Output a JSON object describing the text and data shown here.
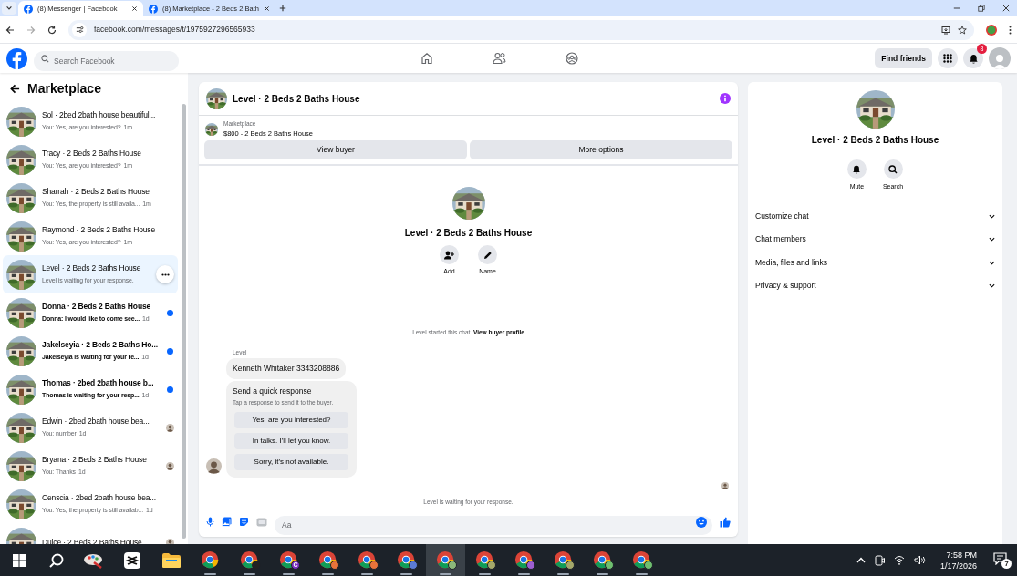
{
  "browser": {
    "tabs": [
      {
        "title": "(8) Messenger | Facebook",
        "selected": true
      },
      {
        "title": "(8) Marketplace - 2 Beds 2 Bath",
        "selected": false
      }
    ],
    "url": "facebook.com/messages/t/1975927296565933"
  },
  "header": {
    "search_placeholder": "Search Facebook",
    "find_friends": "Find friends",
    "notification_count": "8"
  },
  "sidebar": {
    "title": "Marketplace",
    "conversations": [
      {
        "name": "Sol · 2bed 2bath house beautiful...",
        "preview": "You: Yes, are you interested?",
        "time": "1m",
        "unread": false,
        "selected": false,
        "seen": false
      },
      {
        "name": "Tracy · 2 Beds 2 Baths House",
        "preview": "You: Yes, are you interested?",
        "time": "1m",
        "unread": false,
        "selected": false,
        "seen": false
      },
      {
        "name": "Sharrah · 2 Beds 2 Baths House",
        "preview": "You: Yes, the property is still availa...",
        "time": "1m",
        "unread": false,
        "selected": false,
        "seen": false
      },
      {
        "name": "Raymond · 2 Beds 2 Baths House",
        "preview": "You: Yes, are you interested?",
        "time": "1m",
        "unread": false,
        "selected": false,
        "seen": false
      },
      {
        "name": "Level · 2 Beds 2 Baths House",
        "preview": "Level is waiting for your response.",
        "unread": false,
        "selected": true,
        "seen": false
      },
      {
        "name": "Donna · 2 Beds 2 Baths House",
        "preview": "Donna: I would like to come see...",
        "time": "1d",
        "unread": true,
        "selected": false,
        "seen": false
      },
      {
        "name": "Jakelseyia · 2 Beds 2 Baths Ho...",
        "preview": "Jakelseyia is waiting for your re...",
        "time": "1d",
        "unread": true,
        "selected": false,
        "seen": false
      },
      {
        "name": "Thomas · 2bed 2bath house b...",
        "preview": "Thomas is waiting for your resp...",
        "time": "1d",
        "unread": true,
        "selected": false,
        "seen": false
      },
      {
        "name": "Edwin · 2bed 2bath house bea...",
        "preview": "You: number",
        "time": "1d",
        "unread": false,
        "selected": false,
        "seen": true
      },
      {
        "name": "Bryana · 2 Beds 2 Baths House",
        "preview": "You: Thanks",
        "time": "1d",
        "unread": false,
        "selected": false,
        "seen": true
      },
      {
        "name": "Censcia · 2bed 2bath house bea...",
        "preview": "You: Yes, the property is still availab...",
        "time": "1d",
        "unread": false,
        "selected": false,
        "seen": false
      },
      {
        "name": "Dulce · 2 Beds 2 Baths House",
        "unread": false,
        "selected": false,
        "seen": true
      }
    ]
  },
  "chat": {
    "title": "Level · 2 Beds 2 Baths House",
    "listing": {
      "source": "Marketplace",
      "item": "$800 - 2 Beds 2 Baths House"
    },
    "buttons": [
      "View buyer",
      "More options"
    ],
    "profile": {
      "title": "Level · 2 Beds 2 Baths House",
      "actions": [
        {
          "kind": "add",
          "label": "Add"
        },
        {
          "kind": "name",
          "label": "Name"
        }
      ]
    },
    "started_note": {
      "text": "Level started this chat.",
      "link": "View buyer profile"
    },
    "sender": "Level",
    "message": "Kenneth Whitaker 3343208886",
    "quick_response": {
      "title": "Send a quick response",
      "subtitle": "Tap a response to send it to the buyer.",
      "options": [
        "Yes, are you interested?",
        "In talks. I'll let you know.",
        "Sorry, it's not available."
      ]
    },
    "waiting_note": "Level is waiting for your response.",
    "composer_placeholder": "Aa"
  },
  "details": {
    "title": "Level · 2 Beds 2 Baths House",
    "actions": [
      {
        "kind": "mute",
        "label": "Mute"
      },
      {
        "kind": "search",
        "label": "Search"
      }
    ],
    "sections": [
      "Customize chat",
      "Chat members",
      "Media, files and links",
      "Privacy & support"
    ]
  },
  "taskbar": {
    "apps": [
      {
        "kind": "paint",
        "selected": false
      },
      {
        "kind": "capcut",
        "selected": false
      },
      {
        "kind": "files",
        "selected": false
      },
      {
        "kind": "chrome",
        "selected": false
      },
      {
        "kind": "profile",
        "color": "#222222",
        "selected": false
      },
      {
        "kind": "profile",
        "color": "#7b2fbf",
        "badge": "C",
        "selected": false
      },
      {
        "kind": "profile",
        "color": "#e8743b",
        "selected": false
      },
      {
        "kind": "profile",
        "color": "#e8743b",
        "selected": false
      },
      {
        "kind": "profile",
        "color": "#5b7bd5",
        "selected": false
      },
      {
        "kind": "profile",
        "color": "#8bb87a",
        "selected": true
      },
      {
        "kind": "profile",
        "color": "#a4a86a",
        "selected": false
      },
      {
        "kind": "profile",
        "color": "#9c5fd0",
        "selected": false
      },
      {
        "kind": "profile",
        "color": "#a4a86a",
        "selected": false
      },
      {
        "kind": "profile",
        "color": "#6fbf6f",
        "selected": false
      },
      {
        "kind": "profile",
        "color": "#6fbf6f",
        "selected": false
      }
    ],
    "time": "7:58 PM",
    "date": "1/17/2026",
    "notification_count": "7"
  }
}
